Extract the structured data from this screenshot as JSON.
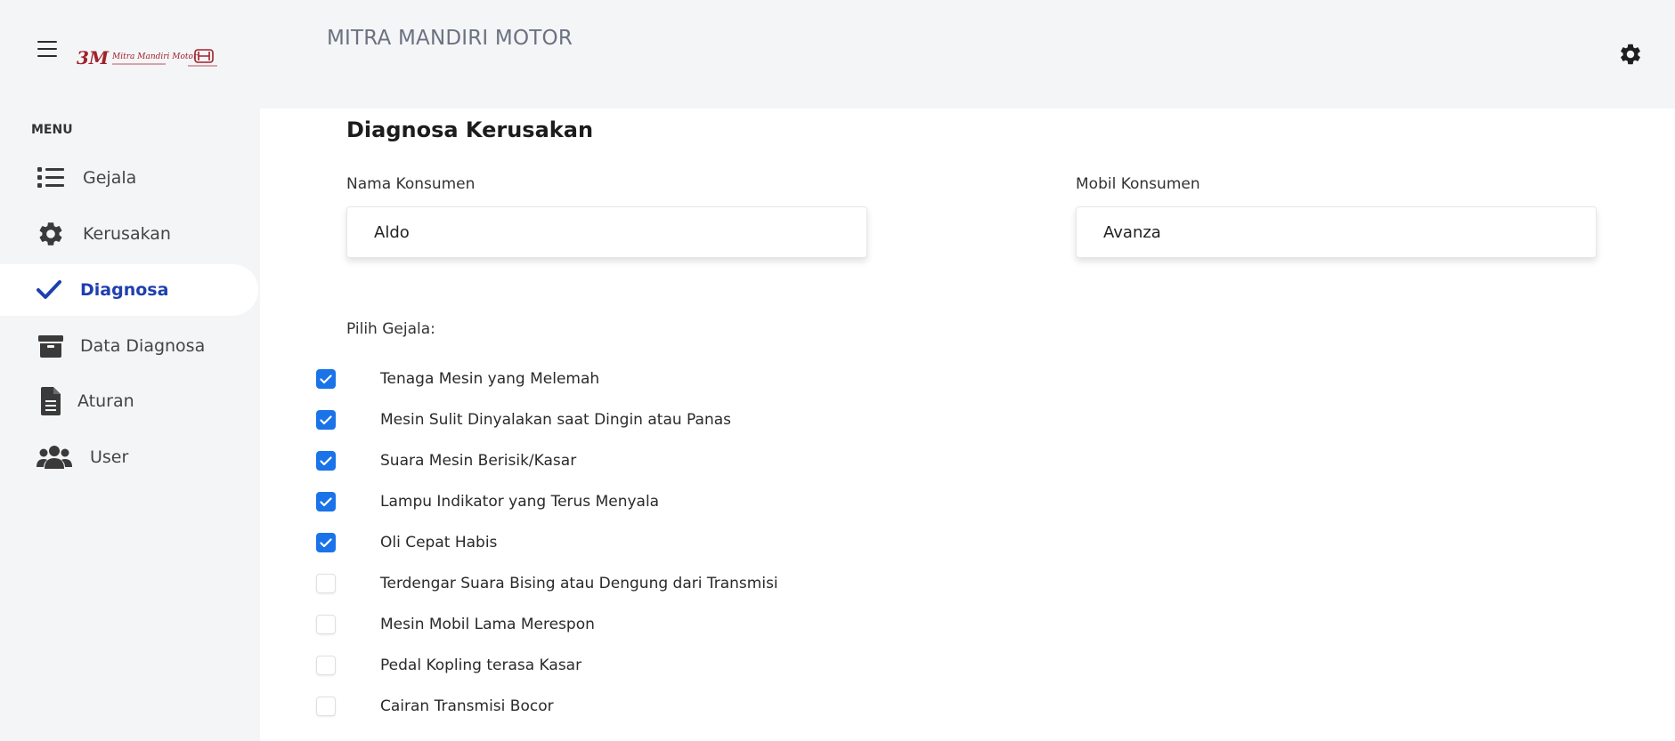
{
  "header": {
    "app_title": "MITRA MANDIRI MOTOR",
    "logo_text": "3M Mitra Mandiri Motor"
  },
  "sidebar": {
    "menu_label": "MENU",
    "items": [
      {
        "label": "Gejala",
        "icon": "list-icon"
      },
      {
        "label": "Kerusakan",
        "icon": "gear-icon"
      },
      {
        "label": "Diagnosa",
        "icon": "check-icon",
        "active": true
      },
      {
        "label": "Data Diagnosa",
        "icon": "box-icon"
      },
      {
        "label": "Aturan",
        "icon": "document-icon"
      },
      {
        "label": "User",
        "icon": "users-icon"
      }
    ]
  },
  "main": {
    "title": "Diagnosa Kerusakan",
    "nama_label": "Nama Konsumen",
    "nama_value": "Aldo",
    "mobil_label": "Mobil Konsumen",
    "mobil_value": "Avanza",
    "gejala_label": "Pilih Gejala:",
    "gejala": [
      {
        "label": "Tenaga Mesin yang Melemah",
        "checked": true
      },
      {
        "label": "Mesin Sulit Dinyalakan saat Dingin atau Panas",
        "checked": true
      },
      {
        "label": "Suara Mesin Berisik/Kasar",
        "checked": true
      },
      {
        "label": "Lampu Indikator yang Terus Menyala",
        "checked": true
      },
      {
        "label": "Oli Cepat Habis",
        "checked": true
      },
      {
        "label": "Terdengar Suara Bising atau Dengung dari Transmisi",
        "checked": false
      },
      {
        "label": "Mesin Mobil Lama Merespon",
        "checked": false
      },
      {
        "label": "Pedal Kopling terasa Kasar",
        "checked": false
      },
      {
        "label": "Cairan Transmisi Bocor",
        "checked": false
      }
    ]
  },
  "colors": {
    "accent": "#1a73e8",
    "active_nav": "#1e3fae",
    "background": "#f4f5f7",
    "logo_red": "#a0222a"
  }
}
